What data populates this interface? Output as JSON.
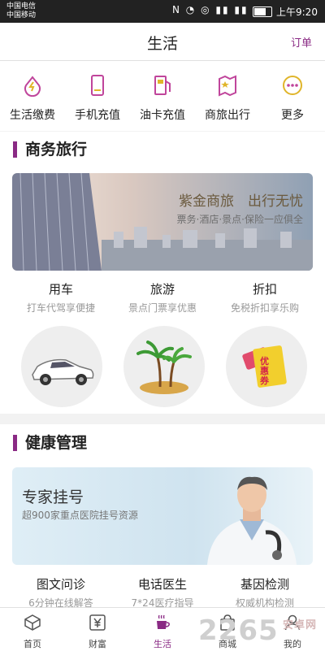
{
  "status_bar": {
    "carrier1": "中国电信",
    "carrier2": "中国移动",
    "time": "上午9:20"
  },
  "header": {
    "title": "生活",
    "orders": "订单"
  },
  "services": [
    {
      "label": "生活缴费",
      "icon": "drop-icon"
    },
    {
      "label": "手机充值",
      "icon": "phone-icon"
    },
    {
      "label": "油卡充值",
      "icon": "fuel-icon"
    },
    {
      "label": "商旅出行",
      "icon": "map-icon"
    },
    {
      "label": "更多",
      "icon": "more-icon"
    }
  ],
  "business_travel": {
    "title": "商务旅行",
    "banner_title": "紫金商旅　出行无忧",
    "banner_sub": "票务·酒店·景点·保险一应俱全",
    "items": [
      {
        "title": "用车",
        "sub": "打车代驾享便捷"
      },
      {
        "title": "旅游",
        "sub": "景点门票享优惠"
      },
      {
        "title": "折扣",
        "sub": "免税折扣享乐购"
      }
    ],
    "coupon_text": "优惠券"
  },
  "health": {
    "title": "健康管理",
    "banner_title": "专家挂号",
    "banner_sub": "超900家重点医院挂号资源",
    "items": [
      {
        "title": "图文问诊",
        "sub": "6分钟在线解答"
      },
      {
        "title": "电话医生",
        "sub": "7*24医疗指导"
      },
      {
        "title": "基因检测",
        "sub": "权威机构检测"
      }
    ]
  },
  "tabs": [
    {
      "label": "首页",
      "icon": "home-icon"
    },
    {
      "label": "财富",
      "icon": "yen-icon"
    },
    {
      "label": "生活",
      "icon": "coffee-icon",
      "active": true
    },
    {
      "label": "商城",
      "icon": "bag-icon"
    },
    {
      "label": "我的",
      "icon": "user-icon"
    }
  ],
  "watermark": {
    "text": "2265",
    "sub": "安卓网"
  },
  "colors": {
    "accent": "#8a2a84",
    "icon_pink": "#c0459b",
    "icon_yellow": "#e0b52a"
  }
}
